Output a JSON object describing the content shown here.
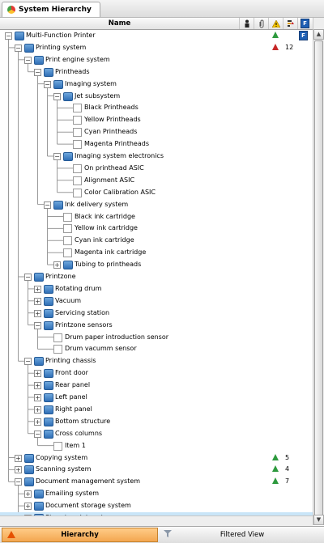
{
  "title_tab": {
    "label": "System Hierarchy"
  },
  "header": {
    "name_label": "Name"
  },
  "tree": [
    {
      "label": "Multi-Function Printer",
      "level": 0,
      "expanded": true,
      "icon": "folder-blue",
      "status": "green",
      "flag": true
    },
    {
      "label": "Printing system",
      "level": 1,
      "expanded": true,
      "icon": "folder-blue",
      "status": "red",
      "count": "12"
    },
    {
      "label": "Print engine system",
      "level": 2,
      "expanded": true,
      "icon": "folder-blue"
    },
    {
      "label": "Printheads",
      "level": 3,
      "expanded": true,
      "icon": "folder-blue"
    },
    {
      "label": "Imaging system",
      "level": 4,
      "expanded": true,
      "icon": "folder-blue"
    },
    {
      "label": "Jet subsystem",
      "level": 5,
      "expanded": true,
      "icon": "folder-blue"
    },
    {
      "label": "Black Printheads",
      "level": 6,
      "icon": "leaf"
    },
    {
      "label": "Yellow Printheads",
      "level": 6,
      "icon": "leaf"
    },
    {
      "label": "Cyan Printheads",
      "level": 6,
      "icon": "leaf"
    },
    {
      "label": "Magenta Printheads",
      "level": 6,
      "icon": "leaf"
    },
    {
      "label": "Imaging system electronics",
      "level": 5,
      "expanded": true,
      "icon": "folder-blue"
    },
    {
      "label": "On printhead ASIC",
      "level": 6,
      "icon": "leaf"
    },
    {
      "label": "Alignment ASIC",
      "level": 6,
      "icon": "leaf"
    },
    {
      "label": "Color Calibration ASIC",
      "level": 6,
      "icon": "leaf"
    },
    {
      "label": "Ink delivery system",
      "level": 4,
      "expanded": true,
      "icon": "folder-blue"
    },
    {
      "label": "Black ink cartridge",
      "level": 5,
      "icon": "leaf"
    },
    {
      "label": "Yellow ink cartridge",
      "level": 5,
      "icon": "leaf"
    },
    {
      "label": "Cyan ink cartridge",
      "level": 5,
      "icon": "leaf"
    },
    {
      "label": "Magenta ink cartridge",
      "level": 5,
      "icon": "leaf"
    },
    {
      "label": "Tubing to printheads",
      "level": 5,
      "expanded": false,
      "icon": "folder-blue"
    },
    {
      "label": "Printzone",
      "level": 2,
      "expanded": true,
      "icon": "folder-blue"
    },
    {
      "label": "Rotating drum",
      "level": 3,
      "expanded": false,
      "icon": "folder-blue"
    },
    {
      "label": "Vacuum",
      "level": 3,
      "expanded": false,
      "icon": "folder-blue"
    },
    {
      "label": "Servicing station",
      "level": 3,
      "expanded": false,
      "icon": "folder-blue"
    },
    {
      "label": "Printzone sensors",
      "level": 3,
      "expanded": true,
      "icon": "folder-blue"
    },
    {
      "label": "Drum paper introduction sensor",
      "level": 4,
      "icon": "leaf"
    },
    {
      "label": "Drum vacumm sensor",
      "level": 4,
      "icon": "leaf"
    },
    {
      "label": "Printing chassis",
      "level": 2,
      "expanded": true,
      "icon": "folder-blue"
    },
    {
      "label": "Front door",
      "level": 3,
      "expanded": false,
      "icon": "folder-blue"
    },
    {
      "label": "Rear panel",
      "level": 3,
      "expanded": false,
      "icon": "folder-blue"
    },
    {
      "label": "Left panel",
      "level": 3,
      "expanded": false,
      "icon": "folder-blue"
    },
    {
      "label": "Right panel",
      "level": 3,
      "expanded": false,
      "icon": "folder-blue"
    },
    {
      "label": "Bottom structure",
      "level": 3,
      "expanded": false,
      "icon": "folder-blue"
    },
    {
      "label": "Cross columns",
      "level": 3,
      "expanded": true,
      "icon": "folder-blue"
    },
    {
      "label": "Item 1",
      "level": 4,
      "icon": "leaf"
    },
    {
      "label": "Copying system",
      "level": 1,
      "expanded": false,
      "icon": "folder-blue",
      "status": "green",
      "count": "5"
    },
    {
      "label": "Scanning system",
      "level": 1,
      "expanded": false,
      "icon": "folder-blue",
      "status": "green",
      "count": "4"
    },
    {
      "label": "Document management system",
      "level": 1,
      "expanded": true,
      "icon": "folder-blue",
      "status": "green",
      "count": "7"
    },
    {
      "label": "Emailing system",
      "level": 2,
      "expanded": false,
      "icon": "folder-blue"
    },
    {
      "label": "Document storage system",
      "level": 2,
      "expanded": false,
      "icon": "folder-blue"
    },
    {
      "label": "Store to print system",
      "level": 2,
      "expanded": false,
      "icon": "folder-blue",
      "selected": true
    }
  ],
  "bottom_tabs": {
    "hierarchy": "Hierarchy",
    "filtered": "Filtered View"
  },
  "colors": {
    "selected_row": "#c9e5f8",
    "active_tab": "#f3a650",
    "status_green": "#2e9a3e",
    "status_red": "#c62828"
  }
}
